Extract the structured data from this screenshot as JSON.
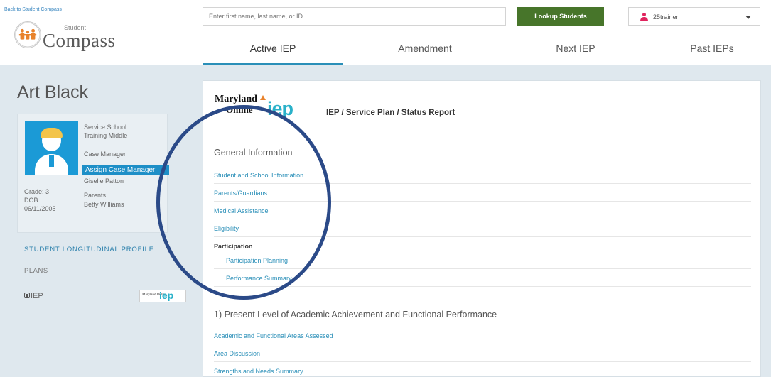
{
  "header": {
    "back_link": "Back to Student Compass",
    "logo_small": "Student",
    "logo_big": "Compass",
    "search_placeholder": "Enter first name, last name, or ID",
    "lookup_label": "Lookup Students",
    "user_name": "25trainer"
  },
  "tabs": [
    {
      "label": "Active IEP",
      "active": true
    },
    {
      "label": "Amendment",
      "active": false
    },
    {
      "label": "Next IEP",
      "active": false
    },
    {
      "label": "Past IEPs",
      "active": false
    }
  ],
  "student": {
    "name": "Art Black",
    "service_school_label": "Service School",
    "service_school": "Training Middle",
    "case_manager_label": "Case Manager",
    "assign_case_manager": "Assign Case Manager",
    "case_manager": "Giselle Patton",
    "grade": "Grade: 3",
    "dob_label": "DOB",
    "dob": "06/11/2005",
    "parents_label": "Parents",
    "parents": "Betty Williams"
  },
  "sidebar": {
    "longitudinal": "STUDENT LONGITUDINAL PROFILE",
    "plans": "PLANS",
    "iep": "IEP",
    "small_logo_text": "Maryland Online",
    "small_logo_iep": "iep"
  },
  "main": {
    "logo_maryland": "Maryland",
    "logo_online": "Online",
    "logo_iep": "iep",
    "title": "IEP / Service Plan / Status Report",
    "general_heading": "General Information",
    "general_items": [
      "Student and School Information",
      "Parents/Guardians",
      "Medical Assistance",
      "Eligibility"
    ],
    "participation_label": "Participation",
    "participation_items": [
      "Participation Planning",
      "Performance Summary"
    ],
    "present_heading": "1) Present Level of Academic Achievement and Functional Performance",
    "present_items": [
      "Academic and Functional Areas Assessed",
      "Area Discussion",
      "Strengths and Needs Summary"
    ]
  },
  "colors": {
    "accent": "#2a8fb8",
    "lookup_button": "#47752a",
    "assign_button": "#1e8fc7",
    "annotation_circle": "#2b4a88"
  }
}
